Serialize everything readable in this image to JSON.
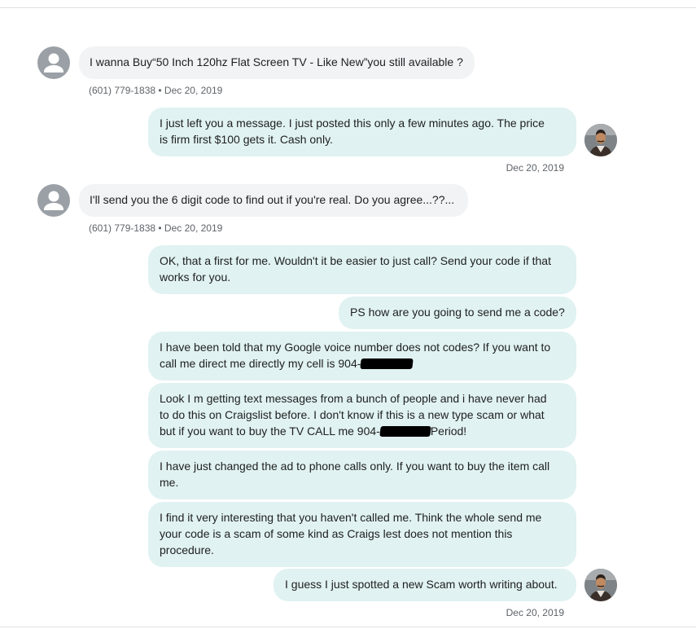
{
  "messages": [
    {
      "id": "m1",
      "direction": "in",
      "text": "I wanna Buy“50 Inch 120hz Flat Screen TV - Like New”you still available ?",
      "meta": "(601) 779-1838 • Dec 20, 2019"
    },
    {
      "id": "m2",
      "direction": "out",
      "text_lines": [
        "I just left you a message. I just posted this only a few minutes ago. The price",
        "is firm first $100 gets it. Cash only."
      ],
      "meta": "Dec 20, 2019"
    },
    {
      "id": "m3",
      "direction": "in",
      "text": "I'll send you the 6 digit code to find out if you're real. Do you agree...??...",
      "meta": "(601) 779-1838 • Dec 20, 2019"
    },
    {
      "id": "m4",
      "direction": "out",
      "text_lines": [
        "OK, that a first for me. Wouldn't it be easier to just call? Send your code if that",
        "works for you."
      ]
    },
    {
      "id": "m5",
      "direction": "out",
      "text": "PS how are you going to send me a code?"
    },
    {
      "id": "m6",
      "direction": "out",
      "text_lines": [
        "I have been told that my Google voice number does not codes? If you want to",
        "call me direct me directly my cell is 904-"
      ]
    },
    {
      "id": "m7",
      "direction": "out",
      "text_lines": [
        "Look I m getting text messages from a bunch of people and i have never had",
        "to do this on Craigslist before. I don't know if this is a new type scam or what",
        "but if you want to buy the TV CALL me 904-",
        "Period!"
      ]
    },
    {
      "id": "m8",
      "direction": "out",
      "text_lines": [
        "I have just changed the ad to phone calls only. If you want to buy the item call",
        "me."
      ]
    },
    {
      "id": "m9",
      "direction": "out",
      "text_lines": [
        "I find it very interesting that you haven't called me.  Think the whole send me",
        "your code is a scam of some kind as Craigs lest does not mention this",
        "procedure."
      ]
    },
    {
      "id": "m10",
      "direction": "out",
      "text": "I guess I just spotted a new Scam worth writing about.",
      "meta": "Dec 20, 2019"
    }
  ],
  "icons": {
    "contact_avatar": "person-icon",
    "own_avatar": "profile-photo"
  },
  "colors": {
    "incoming_bubble": "#f1f3f4",
    "outgoing_bubble": "#e0f2f1",
    "avatar_default": "#9aa0a6",
    "meta_text": "#5f6368"
  }
}
